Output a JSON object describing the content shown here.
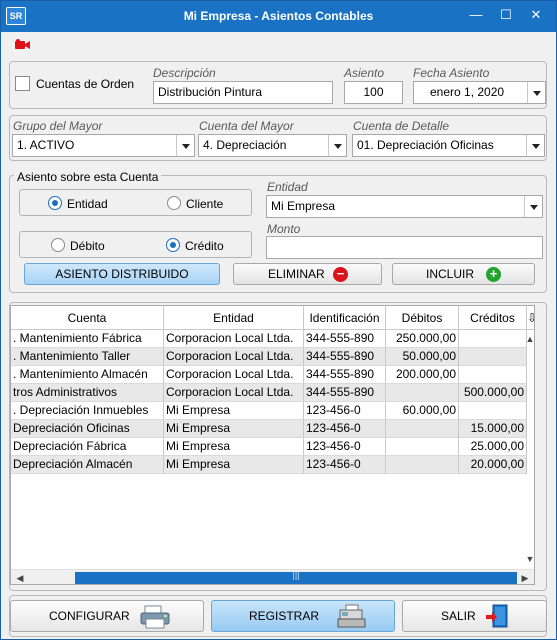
{
  "window": {
    "app_badge": "SR",
    "title": "Mi Empresa - Asientos Contables",
    "controls": {
      "minimize": "—",
      "maximize": "☐",
      "close": "✕"
    }
  },
  "header": {
    "cuentas_orden_label": "Cuentas de Orden",
    "cuentas_orden_checked": false,
    "descripcion_label": "Descripción",
    "descripcion_value": "Distribución Pintura",
    "asiento_label": "Asiento",
    "asiento_value": "100",
    "fecha_label": "Fecha Asiento",
    "fecha_value": "enero 1, 2020"
  },
  "cuentas": {
    "grupo_label": "Grupo del Mayor",
    "grupo_value": "1. ACTIVO",
    "cuenta_mayor_label": "Cuenta del Mayor",
    "cuenta_mayor_value": "4. Depreciación",
    "cuenta_detalle_label": "Cuenta de Detalle",
    "cuenta_detalle_value": "01. Depreciación Oficinas"
  },
  "asiento_cuenta": {
    "legend": "Asiento sobre esta Cuenta",
    "opt_entidad": "Entidad",
    "opt_cliente": "Cliente",
    "selected_tipo": "Entidad",
    "opt_debito": "Débito",
    "opt_credito": "Crédito",
    "selected_mov": "Crédito",
    "entidad_label": "Entidad",
    "entidad_value": "Mi Empresa",
    "monto_label": "Monto",
    "monto_value": "",
    "btn_distribuido": "ASIENTO DISTRIBUIDO",
    "btn_eliminar": "ELIMINAR",
    "btn_incluir": "INCLUIR"
  },
  "grid": {
    "columns": [
      "Cuenta",
      "Entidad",
      "Identificación",
      "Débitos",
      "Créditos"
    ],
    "rows": [
      {
        "cuenta": ". Mantenimiento Fábrica",
        "entidad": "Corporacion Local Ltda.",
        "id": "344-555-890",
        "debitos": "250.000,00",
        "creditos": ""
      },
      {
        "cuenta": ". Mantenimiento Taller",
        "entidad": "Corporacion Local Ltda.",
        "id": "344-555-890",
        "debitos": "50.000,00",
        "creditos": ""
      },
      {
        "cuenta": ". Mantenimiento Almacén",
        "entidad": "Corporacion Local Ltda.",
        "id": "344-555-890",
        "debitos": "200.000,00",
        "creditos": ""
      },
      {
        "cuenta": "tros Administrativos",
        "entidad": "Corporacion Local Ltda.",
        "id": "344-555-890",
        "debitos": "",
        "creditos": "500.000,00"
      },
      {
        "cuenta": ". Depreciación Inmuebles",
        "entidad": "Mi Empresa",
        "id": "123-456-0",
        "debitos": "60.000,00",
        "creditos": ""
      },
      {
        "cuenta": "Depreciación Oficinas",
        "entidad": "Mi Empresa",
        "id": "123-456-0",
        "debitos": "",
        "creditos": "15.000,00"
      },
      {
        "cuenta": "Depreciación Fábrica",
        "entidad": "Mi Empresa",
        "id": "123-456-0",
        "debitos": "",
        "creditos": "25.000,00"
      },
      {
        "cuenta": "Depreciación Almacén",
        "entidad": "Mi Empresa",
        "id": "123-456-0",
        "debitos": "",
        "creditos": "20.000,00"
      }
    ],
    "scrollbar_grip": "|||"
  },
  "footer": {
    "configurar": "CONFIGURAR",
    "registrar": "REGISTRAR",
    "salir": "SALIR"
  },
  "colors": {
    "titlebar": "#1a72c4",
    "accent": "#1a6fc0",
    "eliminar_icon": "#d9151b",
    "incluir_icon": "#21a52c"
  }
}
